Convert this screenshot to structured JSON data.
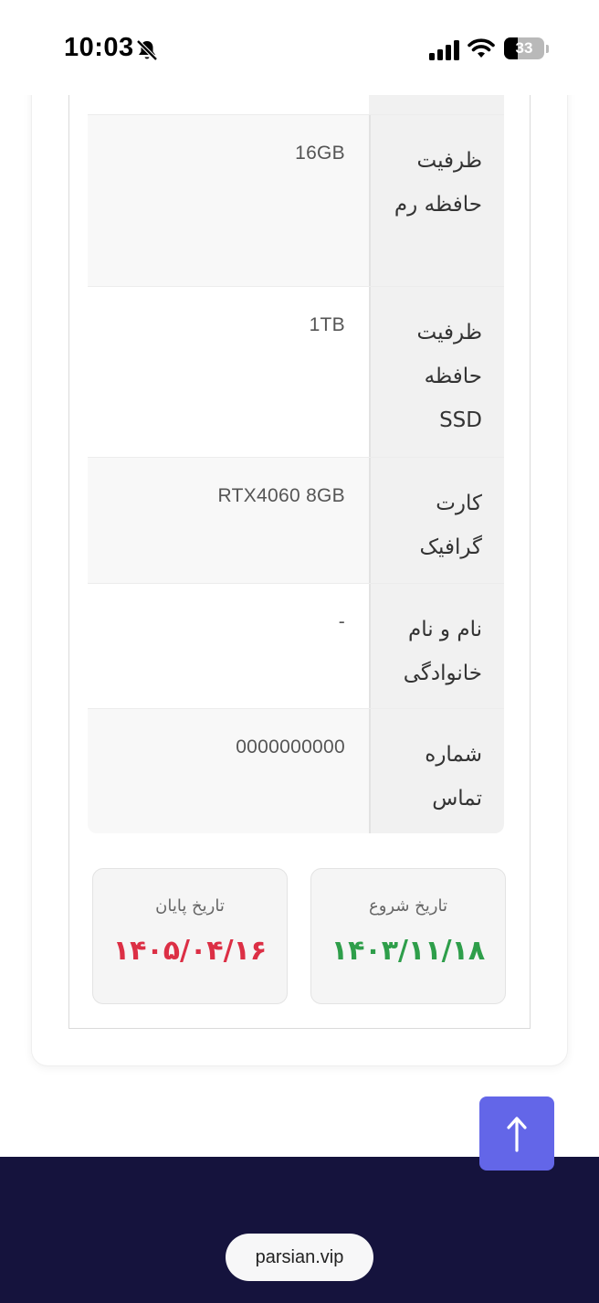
{
  "status_bar": {
    "time": "10:03",
    "battery": "33",
    "battery_level": 0.33
  },
  "specs": [
    {
      "label": "ظرفیت حافظه رم",
      "value": "16GB"
    },
    {
      "label": "ظرفیت حافظه SSD",
      "value": "1TB"
    },
    {
      "label": "کارت گرافیک",
      "value": "RTX4060 8GB"
    },
    {
      "label": "نام و نام خانوادگی",
      "value": "-"
    },
    {
      "label": "شماره تماس",
      "value": "0000000000"
    }
  ],
  "dates": {
    "start": {
      "title": "تاریخ شروع",
      "value": "۱۴۰۳/۱۱/۱۸",
      "color": "#2e9e4a"
    },
    "end": {
      "title": "تاریخ پایان",
      "value": "۱۴۰۵/۰۴/۱۶",
      "color": "#dc2f45"
    }
  },
  "colors": {
    "accent": "#6366e8",
    "footer": "#15133d"
  },
  "scroll_top": {
    "icon": "arrow-up-icon"
  },
  "footer": {
    "url": "parsian.vip"
  }
}
